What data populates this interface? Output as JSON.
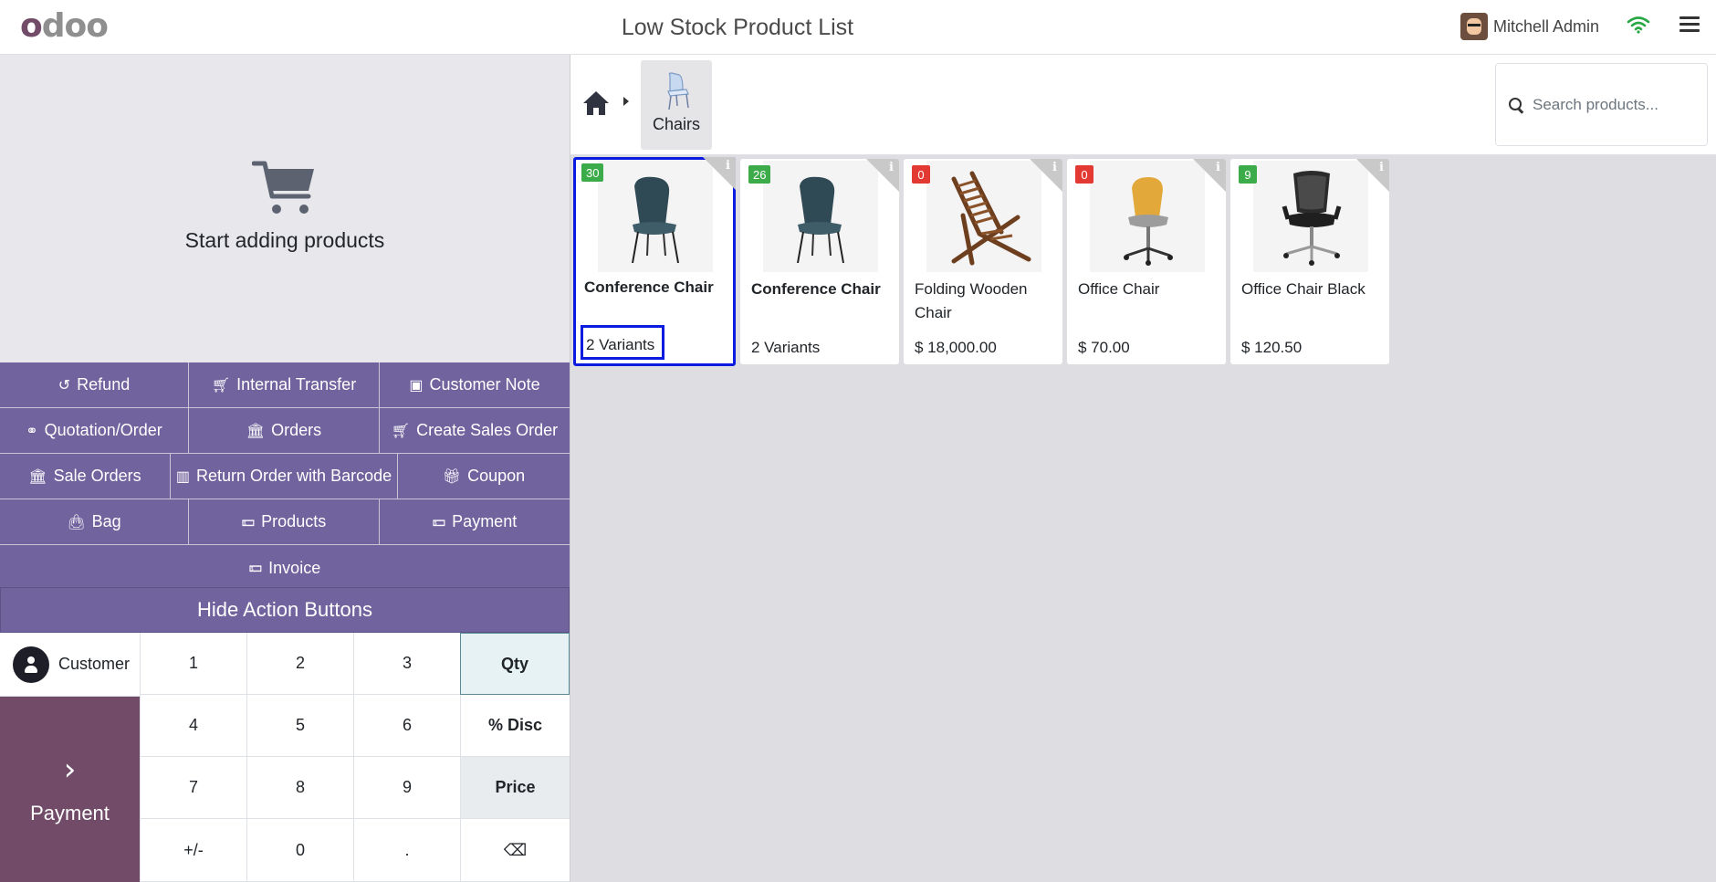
{
  "header": {
    "logo_text": "odoo",
    "title": "Low Stock Product List",
    "user_name": "Mitchell Admin",
    "icons": [
      "wifi-icon",
      "hamburger-menu-icon"
    ]
  },
  "order": {
    "empty_text": "Start adding products"
  },
  "actions": {
    "rows": [
      [
        {
          "label": "Refund",
          "icon": "undo-icon"
        },
        {
          "label": "Internal Transfer",
          "icon": "cart-icon"
        },
        {
          "label": "Customer Note",
          "icon": "note-icon"
        }
      ],
      [
        {
          "label": "Quotation/Order",
          "icon": "link-icon"
        },
        {
          "label": "Orders",
          "icon": "bank-icon"
        },
        {
          "label": "Create Sales Order",
          "icon": "cart-icon"
        }
      ],
      [
        {
          "label": "Sale Orders",
          "icon": "bank-icon"
        },
        {
          "label": "Return Order with Barcode",
          "icon": "barcode-icon"
        },
        {
          "label": "Coupon",
          "icon": "gift-icon"
        }
      ],
      [
        {
          "label": "Bag",
          "icon": "bag-icon"
        },
        {
          "label": "Products",
          "icon": "money-icon"
        },
        {
          "label": "Payment",
          "icon": "money-icon"
        }
      ],
      [
        {
          "label": "Invoice",
          "icon": "money-icon"
        }
      ]
    ],
    "hide_label": "Hide Action Buttons"
  },
  "numpad": {
    "customer_label": "Customer",
    "payment_label": "Payment",
    "keys": [
      "1",
      "2",
      "3",
      "Qty",
      "4",
      "5",
      "6",
      "% Disc",
      "7",
      "8",
      "9",
      "Price",
      "+/-",
      "0",
      ".",
      "⌫"
    ],
    "active_mode": "Qty"
  },
  "breadcrumb": {
    "category": "Chairs"
  },
  "search": {
    "placeholder": "Search products..."
  },
  "products": [
    {
      "name": "Conference Chair",
      "stock": "30",
      "stock_color": "#3cab4a",
      "sub": "2 Variants",
      "bold": true,
      "image": "teal-chair-icon"
    },
    {
      "name": "Conference Chair",
      "stock": "26",
      "stock_color": "#3cab4a",
      "sub": "2 Variants",
      "bold": true,
      "image": "teal-chair-icon"
    },
    {
      "name": "Folding Wooden Chair",
      "stock": "0",
      "stock_color": "#e23a32",
      "sub": "$ 18,000.00",
      "bold": false,
      "image": "wooden-deck-chair-icon"
    },
    {
      "name": "Office Chair",
      "stock": "0",
      "stock_color": "#e23a32",
      "sub": "$ 70.00",
      "bold": false,
      "image": "yellow-office-chair-icon"
    },
    {
      "name": "Office Chair Black",
      "stock": "9",
      "stock_color": "#3cab4a",
      "sub": "$ 120.50",
      "bold": false,
      "image": "black-office-chair-icon"
    }
  ],
  "colors": {
    "action_purple": "#71639e",
    "payment_plum": "#714b67",
    "selection_blue": "#0b1be0"
  }
}
